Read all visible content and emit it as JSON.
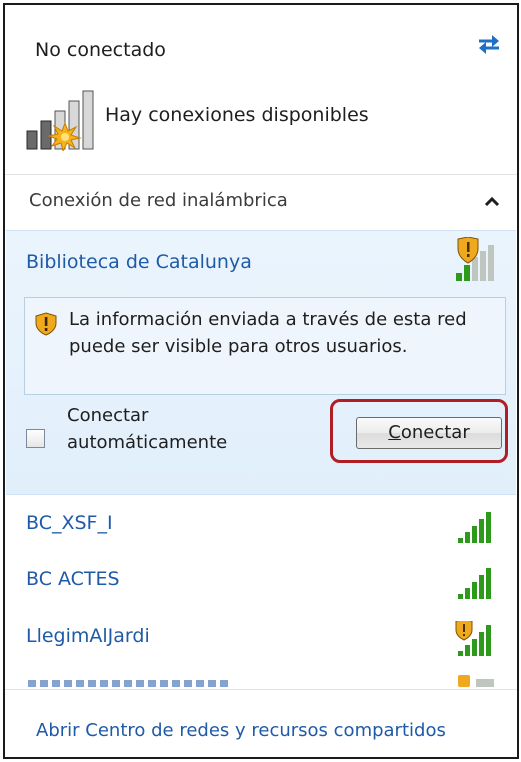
{
  "status": {
    "title": "No conectado",
    "subtitle": "Hay conexiones disponibles"
  },
  "section": {
    "label": "Conexión de red inalámbrica"
  },
  "selected_network": {
    "name": "Biblioteca de Catalunya",
    "warning": "La información enviada a través de esta red puede ser visible para otros usuarios.",
    "auto_connect_label": "Conectar automáticamente",
    "auto_connect_checked": false,
    "connect_button": "Conectar",
    "secured": false
  },
  "networks": [
    {
      "name": "BC_XSF_I",
      "secured": true,
      "signal_bars": 5
    },
    {
      "name": "BC ACTES",
      "secured": true,
      "signal_bars": 5
    },
    {
      "name": "LlegimAlJardi",
      "secured": false,
      "signal_bars": 5
    }
  ],
  "footer": {
    "link": "Abrir Centro de redes y recursos compartidos"
  },
  "colors": {
    "link_blue": "#1f5aa8",
    "signal_green": "#2e9a1c",
    "highlight_frame": "#b01e24",
    "warning_shield": "#e8a317"
  }
}
